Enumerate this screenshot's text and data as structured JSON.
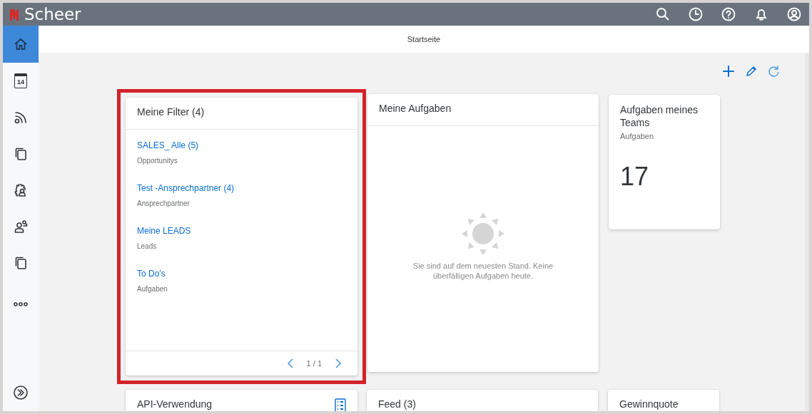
{
  "brand": {
    "name": "Scheer"
  },
  "sidebar": {
    "items": [
      {
        "selected": true
      },
      {
        "selected": false,
        "text": "14"
      },
      {
        "selected": false
      },
      {
        "selected": false
      },
      {
        "selected": false
      },
      {
        "selected": false
      },
      {
        "selected": false
      },
      {
        "selected": false
      }
    ]
  },
  "page_title": "Startseite",
  "filter_card": {
    "title": "Meine Filter (4)",
    "highlighted": true,
    "items": [
      {
        "title": "SALES_ Alle (5)",
        "subtitle": "Opportunitys"
      },
      {
        "title": "Test -Ansprechpartner (4)",
        "subtitle": "Ansprechpartner"
      },
      {
        "title": "Meine LEADS",
        "subtitle": "Leads"
      },
      {
        "title": "To Do's",
        "subtitle": "Aufgaben"
      }
    ],
    "pager": "1 / 1"
  },
  "tasks_card": {
    "title": "Meine Aufgaben",
    "message": "Sie sind auf dem neuesten Stand. Keine überfälligen Aufgaben heute."
  },
  "team_card": {
    "title": "Aufgaben meines Teams",
    "subtitle": "Aufgaben",
    "value": "17"
  },
  "bottom_cards": [
    {
      "title": "API-Verwendung"
    },
    {
      "title": "Feed (3)"
    },
    {
      "title": "Gewinnquote"
    }
  ]
}
